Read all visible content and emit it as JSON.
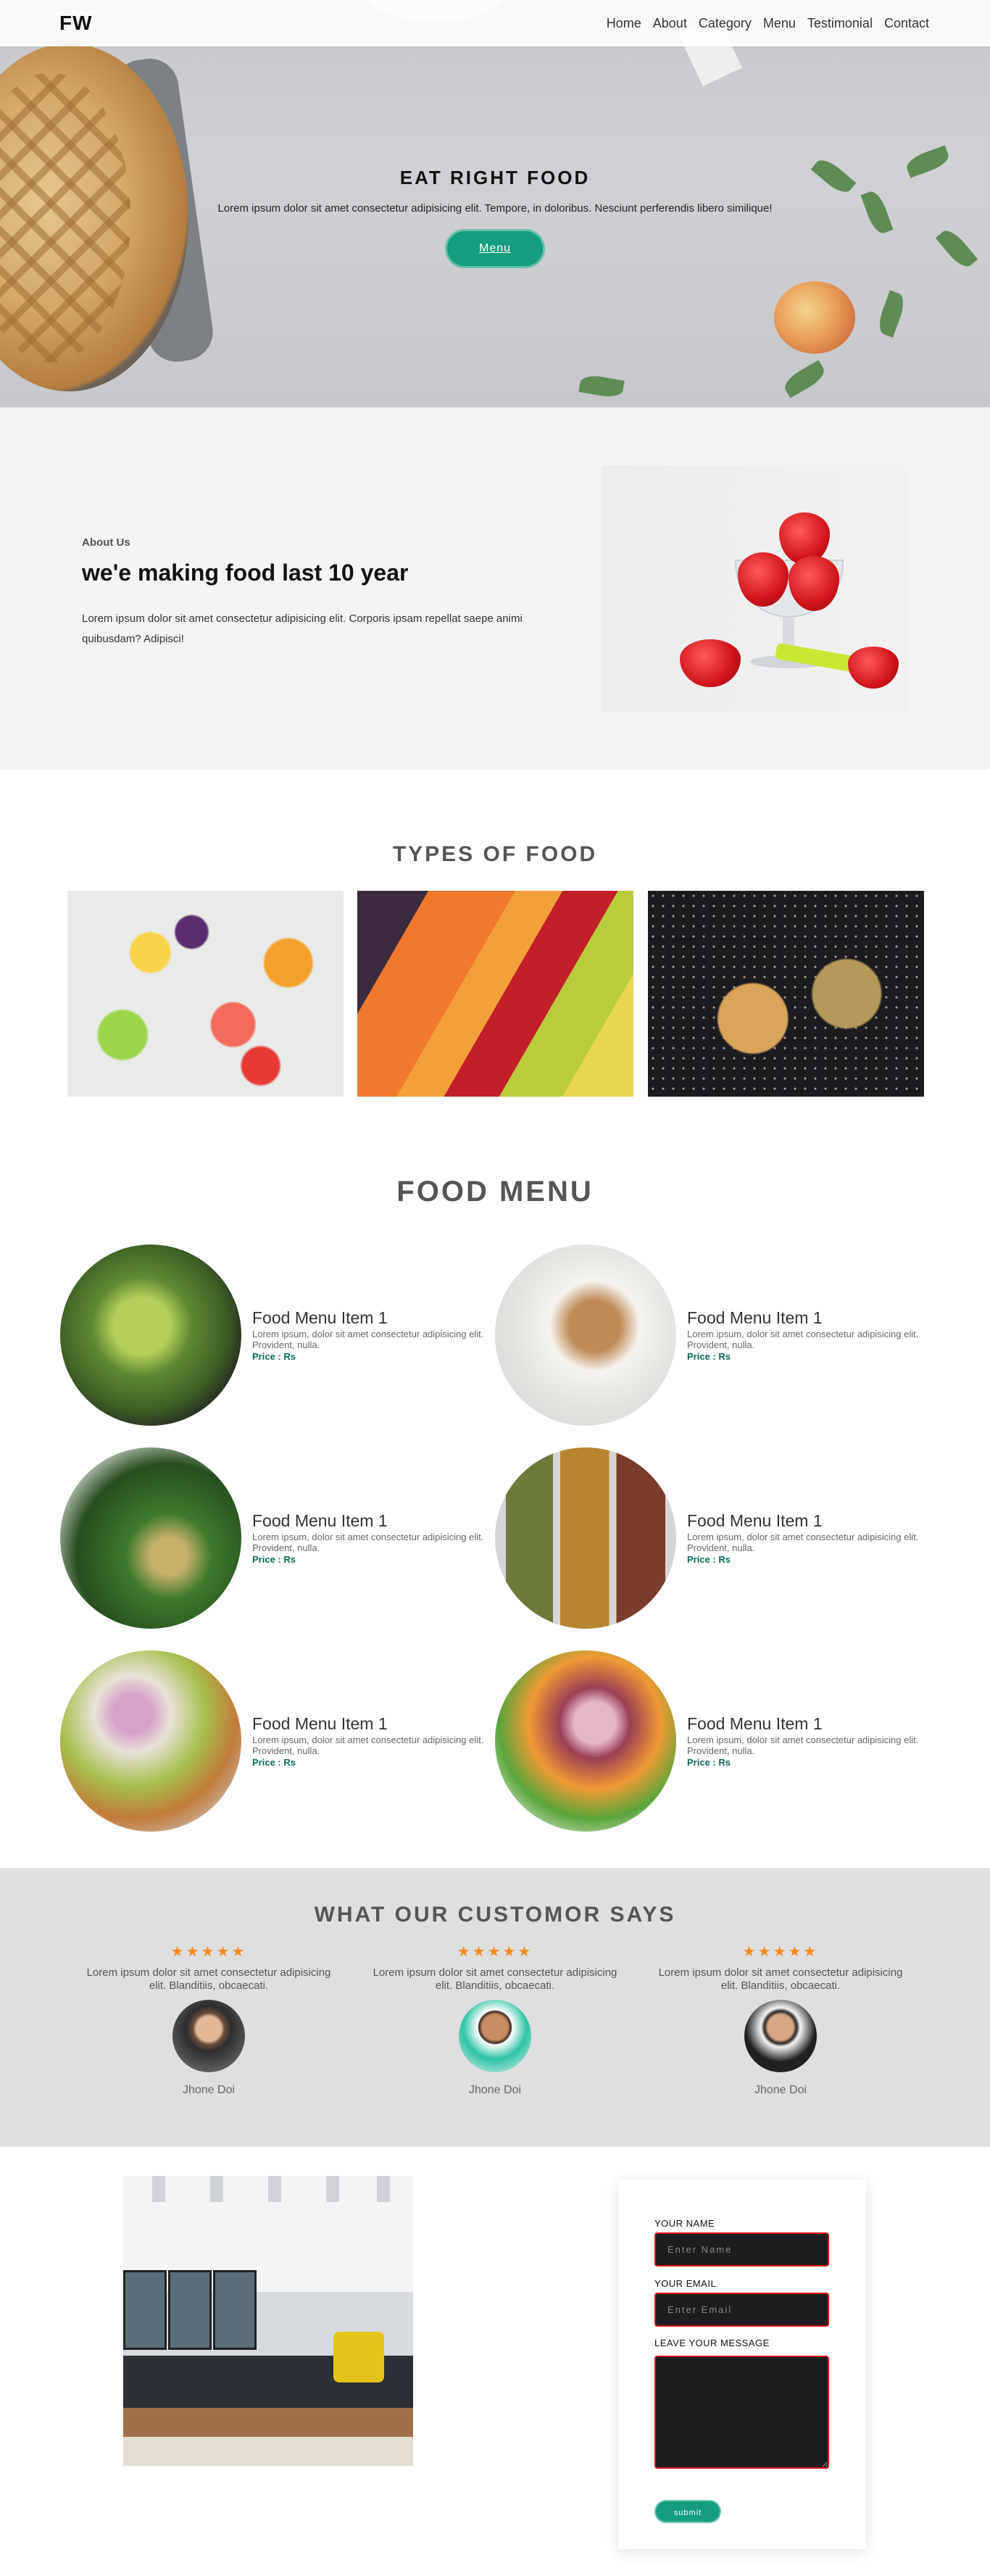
{
  "nav": {
    "logo": "FW",
    "links": [
      "Home",
      "About",
      "Category",
      "Menu",
      "Testimonial",
      "Contact"
    ]
  },
  "hero": {
    "title": "EAT RIGHT FOOD",
    "text": "Lorem ipsum dolor sit amet consectetur adipisicing elit. Tempore, in doloribus. Nesciunt perferendis libero similique!",
    "button": "Menu"
  },
  "about": {
    "label": "About Us",
    "title": "we'e making food last 10 year",
    "text": "Lorem ipsum dolor sit amet consectetur adipisicing elit. Corporis ipsam repellat saepe animi quibusdam? Adipisci!"
  },
  "types": {
    "title": "TYPES OF FOOD"
  },
  "menu": {
    "title": "FOOD MENU",
    "items": [
      {
        "name": "Food Menu Item 1",
        "desc": "Lorem ipsum, dolor sit amet consectetur adipisicing elit. Provident, nulla.",
        "price": "Price : Rs"
      },
      {
        "name": "Food Menu Item 1",
        "desc": "Lorem ipsum, dolor sit amet consectetur adipisicing elit. Provident, nulla.",
        "price": "Price : Rs"
      },
      {
        "name": "Food Menu Item 1",
        "desc": "Lorem ipsum, dolor sit amet consectetur adipisicing elit. Provident, nulla.",
        "price": "Price : Rs"
      },
      {
        "name": "Food Menu Item 1",
        "desc": "Lorem ipsum, dolor sit amet consectetur adipisicing elit. Provident, nulla.",
        "price": "Price : Rs"
      },
      {
        "name": "Food Menu Item 1",
        "desc": "Lorem ipsum, dolor sit amet consectetur adipisicing elit. Provident, nulla.",
        "price": "Price : Rs"
      },
      {
        "name": "Food Menu Item 1",
        "desc": "Lorem ipsum, dolor sit amet consectetur adipisicing elit. Provident, nulla.",
        "price": "Price : Rs"
      }
    ]
  },
  "testimonials": {
    "title": "WHAT OUR CUSTOMOR SAYS",
    "items": [
      {
        "stars": "★★★★★",
        "rating": 5,
        "text": "Lorem ipsum dolor sit amet consectetur adipisicing elit. Blanditiis, obcaecati.",
        "name": "Jhone Doi"
      },
      {
        "stars": "★★★★★",
        "rating": 5,
        "text": "Lorem ipsum dolor sit amet consectetur adipisicing elit. Blanditiis, obcaecati.",
        "name": "Jhone Doi"
      },
      {
        "stars": "★★★★★",
        "rating": 5,
        "text": "Lorem ipsum dolor sit amet consectetur adipisicing elit. Blanditiis, obcaecati.",
        "name": "Jhone Doi"
      }
    ]
  },
  "contact": {
    "name_label": "YOUR NAME",
    "name_placeholder": "Enter Name",
    "email_label": "YOUR EMAIL",
    "email_placeholder": "Enter Email",
    "message_label": "LEAVE YOUR MESSAGE",
    "submit": "submit"
  },
  "colors": {
    "accent": "#149d7e",
    "star": "#f28b1f",
    "input_border": "#dd1111",
    "price": "#0a6b58"
  }
}
